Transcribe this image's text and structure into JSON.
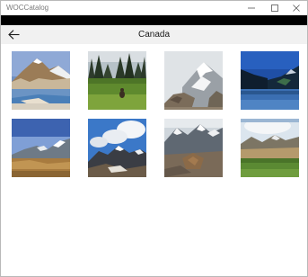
{
  "window": {
    "app_title": "WOCCatalog",
    "controls": [
      "minimize-icon",
      "maximize-icon",
      "close-icon"
    ]
  },
  "header": {
    "title": "Canada",
    "back_icon": "back-arrow-icon"
  },
  "gallery": {
    "photos": [
      {
        "subject": "mountain-lake"
      },
      {
        "subject": "forest-meadow"
      },
      {
        "subject": "snowy-peak"
      },
      {
        "subject": "blue-lake-valley"
      },
      {
        "subject": "alpine-ridge"
      },
      {
        "subject": "clouds-mountains"
      },
      {
        "subject": "rocky-summit"
      },
      {
        "subject": "green-valley"
      }
    ]
  }
}
